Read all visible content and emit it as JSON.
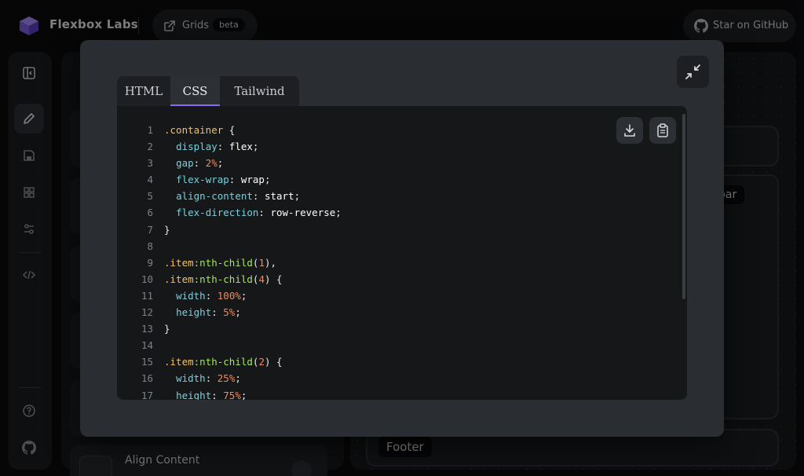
{
  "header": {
    "brand": "Flexbox Labs",
    "grids_label": "Grids",
    "beta_badge": "beta",
    "github_label": "Star on GitHub"
  },
  "sidebar_icons": [
    "sidebar-toggle-icon",
    "pencil-icon",
    "save-icon",
    "grid-icon",
    "sliders-icon",
    "code-icon",
    "help-icon",
    "github-icon"
  ],
  "background": {
    "settings_card_label": "Align Content",
    "preview_tag": "bar",
    "footer_tag": "Footer"
  },
  "modal": {
    "tabs": [
      {
        "label": "HTML",
        "active": false
      },
      {
        "label": "CSS",
        "active": true
      },
      {
        "label": "Tailwind",
        "active": false
      }
    ],
    "code_lines": [
      {
        "n": "1",
        "text": ".container {"
      },
      {
        "n": "2",
        "text": "  display: flex;"
      },
      {
        "n": "3",
        "text": "  gap: 2%;"
      },
      {
        "n": "4",
        "text": "  flex-wrap: wrap;"
      },
      {
        "n": "5",
        "text": "  align-content: start;"
      },
      {
        "n": "6",
        "text": "  flex-direction: row-reverse;"
      },
      {
        "n": "7",
        "text": "}"
      },
      {
        "n": "8",
        "text": ""
      },
      {
        "n": "9",
        "text": ".item:nth-child(1),"
      },
      {
        "n": "10",
        "text": ".item:nth-child(4) {"
      },
      {
        "n": "11",
        "text": "  width: 100%;"
      },
      {
        "n": "12",
        "text": "  height: 5%;"
      },
      {
        "n": "13",
        "text": "}"
      },
      {
        "n": "14",
        "text": ""
      },
      {
        "n": "15",
        "text": ".item:nth-child(2) {"
      },
      {
        "n": "16",
        "text": "  width: 25%;"
      },
      {
        "n": "17",
        "text": "  height: 75%;"
      }
    ]
  },
  "colors": {
    "accent": "#8b6cf0",
    "selector": "#f0c26a",
    "property": "#79d0dd",
    "number": "#f08a5d",
    "pseudo": "#a6e35c"
  }
}
